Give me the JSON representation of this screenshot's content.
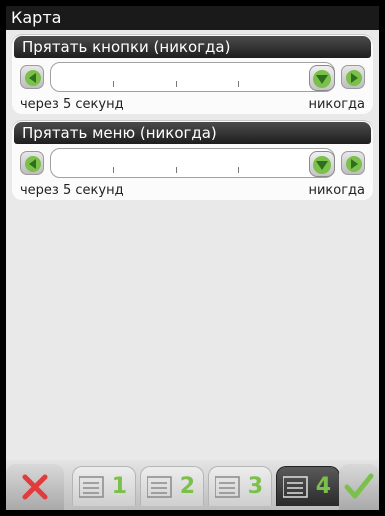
{
  "window": {
    "title": "Карта"
  },
  "panels": [
    {
      "title": "Прятать кнопки (никогда)",
      "min_label": "через 5 секунд",
      "max_label": "никогда",
      "value_fraction": 1.0
    },
    {
      "title": "Прятать меню (никогда)",
      "min_label": "через 5 секунд",
      "max_label": "никогда",
      "value_fraction": 1.0
    }
  ],
  "bottombar": {
    "tabs": [
      "1",
      "2",
      "3",
      "4"
    ],
    "active_tab": "4",
    "icons": {
      "close": "close-icon",
      "ok": "checkmark-icon",
      "tab": "list-icon"
    },
    "colors": {
      "close": "#e23b3b",
      "ok": "#7bc04a",
      "arrows": "#7bc04a"
    }
  }
}
